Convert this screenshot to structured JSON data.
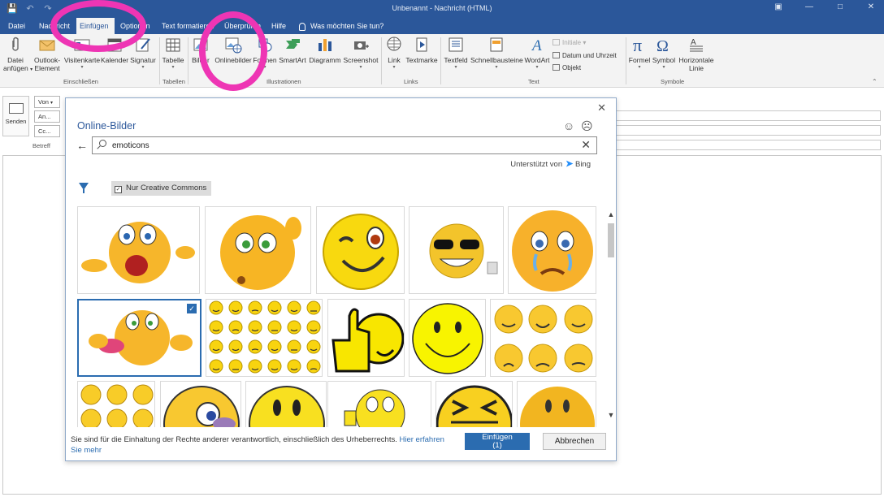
{
  "window": {
    "title": "Unbenannt  -  Nachricht (HTML)"
  },
  "qat": {
    "save_icon": "save-icon",
    "undo_icon": "undo-icon",
    "redo_icon": "redo-icon"
  },
  "tabs": [
    {
      "label": "Datei",
      "active": false
    },
    {
      "label": "Nachricht",
      "active": false
    },
    {
      "label": "Einfügen",
      "active": true
    },
    {
      "label": "Optionen",
      "active": false
    },
    {
      "label": "Text formatieren",
      "active": false
    },
    {
      "label": "Überprüfen",
      "active": false
    },
    {
      "label": "Hilfe",
      "active": false
    }
  ],
  "tell_me": "Was möchten Sie tun?",
  "ribbon": {
    "datei": {
      "label1": "Datei",
      "label2": "anfügen"
    },
    "outlook": {
      "label1": "Outlook-",
      "label2": "Element"
    },
    "visitenkarte": "Visitenkarte",
    "kalender": "Kalender",
    "signatur": "Signatur",
    "tabelle": "Tabelle",
    "bilder": "Bilder",
    "onlinebilder": "Onlinebilder",
    "formen": "Formen",
    "smartart": "SmartArt",
    "diagramm": "Diagramm",
    "screenshot": "Screenshot",
    "link": "Link",
    "textmarke": "Textmarke",
    "textfeld": "Textfeld",
    "schnellbausteine": "Schnellbausteine",
    "wordart": "WordArt",
    "initiale": "Initiale",
    "datum": "Datum und Uhrzeit",
    "objekt": "Objekt",
    "formel": "Formel",
    "symbol": "Symbol",
    "hlinie": {
      "label1": "Horizontale",
      "label2": "Linie"
    },
    "groups": {
      "einschliessen": "Einschließen",
      "tabellen": "Tabellen",
      "illustrationen": "Illustrationen",
      "links": "Links",
      "text": "Text",
      "symbole": "Symbole"
    }
  },
  "compose": {
    "send": "Senden",
    "von": "Von",
    "an": "An...",
    "cc": "Cc...",
    "betreff": "Betreff"
  },
  "dialog": {
    "title": "Online-Bilder",
    "search_value": "emoticons",
    "powered_by": "Unterstützt von",
    "bing": "Bing",
    "filter_label": "Nur Creative Commons",
    "footer_text": "Sie sind für die Einhaltung der Rechte anderer verantwortlich, einschließlich des Urheberrechts.",
    "learn_more": "Hier erfahren",
    "see_more": "Sie mehr",
    "insert_label": "Einfügen",
    "insert_count": "(1)",
    "cancel_label": "Abbrechen"
  },
  "colors": {
    "accent": "#2b579a",
    "highlight": "#ee35b4",
    "emoji": "#f6c22b"
  }
}
